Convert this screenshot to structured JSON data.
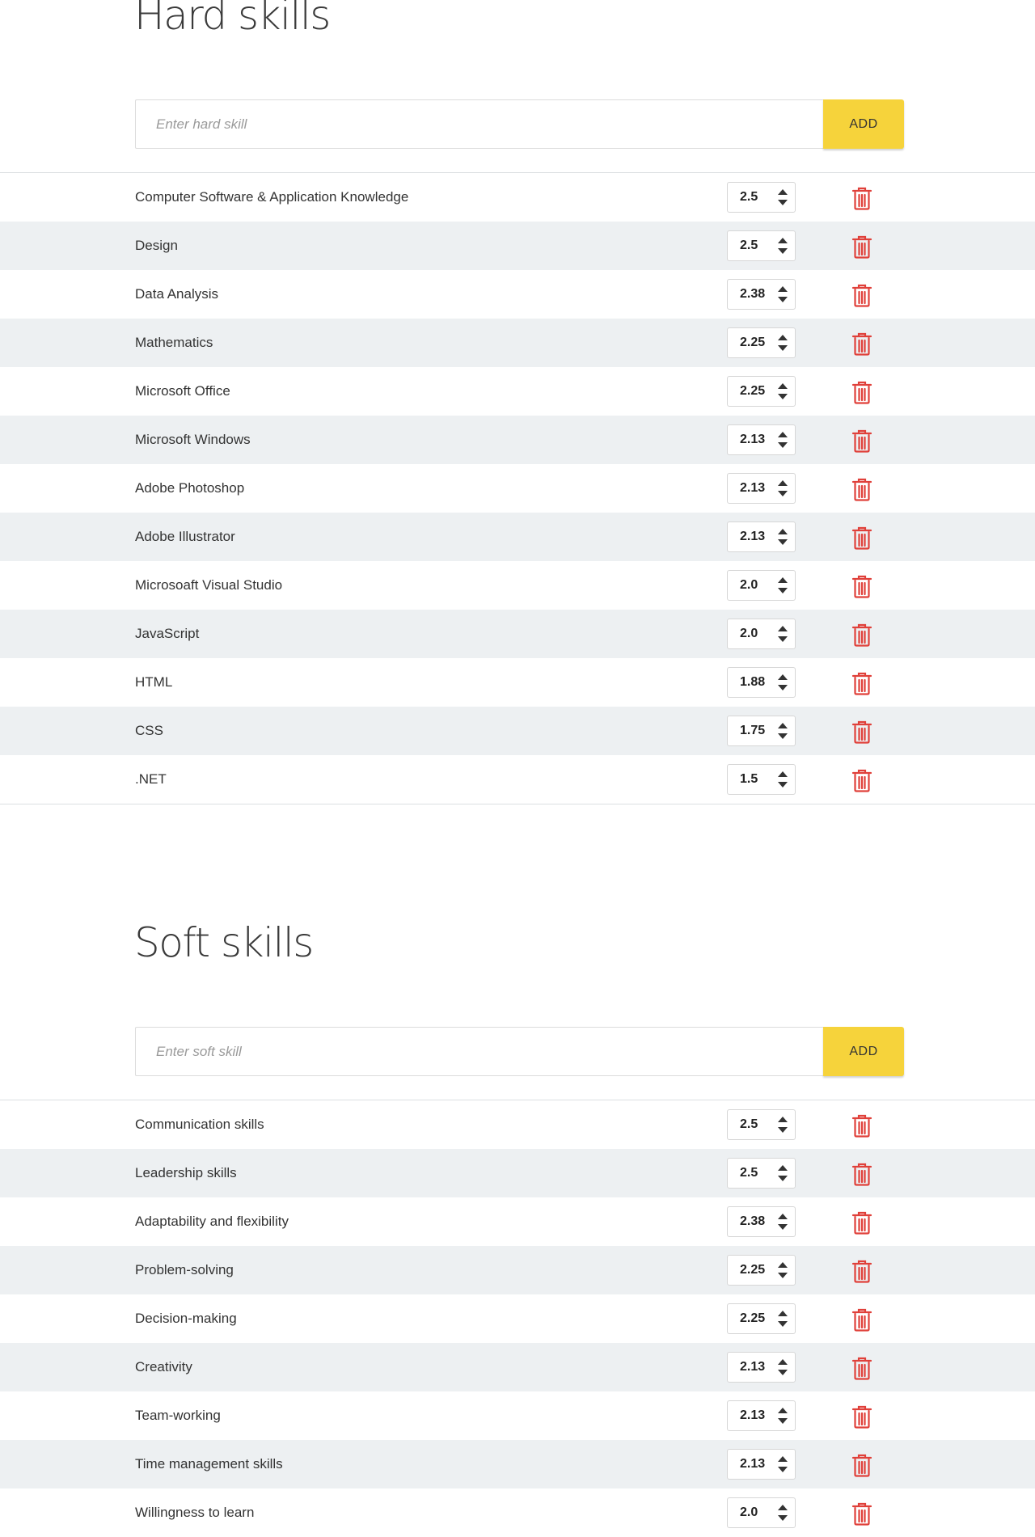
{
  "hard_skills": {
    "title": "Hard skills",
    "input_placeholder": "Enter hard skill",
    "add_label": "ADD",
    "items": [
      {
        "name": "Computer Software & Application Knowledge",
        "value": "2.5"
      },
      {
        "name": "Design",
        "value": "2.5"
      },
      {
        "name": "Data Analysis",
        "value": "2.38"
      },
      {
        "name": "Mathematics",
        "value": "2.25"
      },
      {
        "name": "Microsoft Office",
        "value": "2.25"
      },
      {
        "name": "Microsoft Windows",
        "value": "2.13"
      },
      {
        "name": "Adobe Photoshop",
        "value": "2.13"
      },
      {
        "name": "Adobe Illustrator",
        "value": "2.13"
      },
      {
        "name": "Microsoaft Visual Studio",
        "value": "2.0"
      },
      {
        "name": "JavaScript",
        "value": "2.0"
      },
      {
        "name": "HTML",
        "value": "1.88"
      },
      {
        "name": "CSS",
        "value": "1.75"
      },
      {
        "name": ".NET",
        "value": "1.5"
      }
    ]
  },
  "soft_skills": {
    "title": "Soft skills",
    "input_placeholder": "Enter soft skill",
    "add_label": "ADD",
    "items": [
      {
        "name": "Communication skills",
        "value": "2.5"
      },
      {
        "name": "Leadership skills",
        "value": "2.5"
      },
      {
        "name": "Adaptability and flexibility",
        "value": "2.38"
      },
      {
        "name": "Problem-solving",
        "value": "2.25"
      },
      {
        "name": "Decision-making",
        "value": "2.25"
      },
      {
        "name": "Creativity",
        "value": "2.13"
      },
      {
        "name": "Team-working",
        "value": "2.13"
      },
      {
        "name": "Time management skills",
        "value": "2.13"
      },
      {
        "name": "Willingness to learn",
        "value": "2.0"
      }
    ]
  },
  "colors": {
    "accent_button": "#f6d33b",
    "delete_icon": "#e0403a",
    "row_alt": "#edf0f2"
  },
  "icons": {
    "increment": "caret-up-icon",
    "decrement": "caret-down-icon",
    "delete": "trash-icon"
  }
}
